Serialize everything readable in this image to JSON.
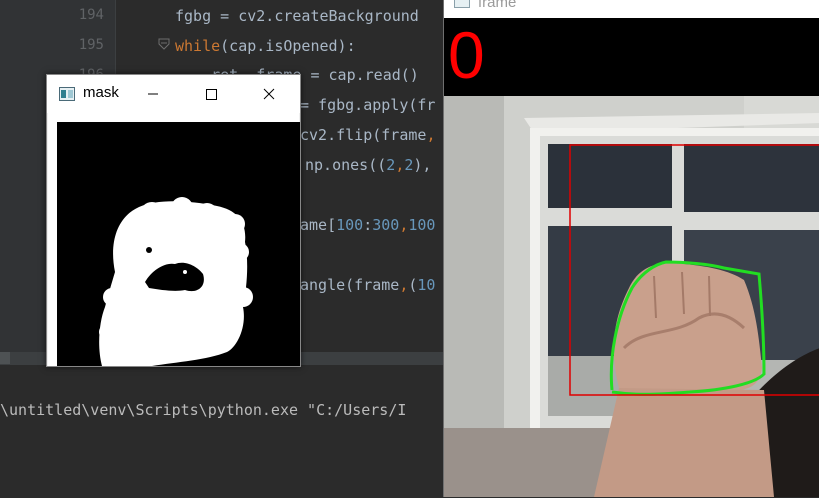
{
  "editor": {
    "line_numbers": [
      "194",
      "195",
      "196"
    ],
    "lines": {
      "l194": "fgbg = cv2.createBackground",
      "l195_kw": "while",
      "l195_rest": "(cap.isOpened):",
      "l196": "    ret, frame = cap.read()",
      "l197": "= fgbg.apply(fr",
      "l198_a": "cv2.flip(frame",
      "l198_b": ",",
      "l199_a": "np.ones((",
      "l199_n1": "2",
      "l199_c1": ",",
      "l199_n2": "2",
      "l199_b": "),",
      "l200_a": "ame[",
      "l200_n1": "100",
      "l200_b": ":",
      "l200_n2": "300",
      "l200_c1": ",",
      "l200_n3": "100",
      "l201_a": "angle(frame",
      "l201_c1": ",",
      "l201_b": "(",
      "l201_n1": "10"
    }
  },
  "console": {
    "command": "\\untitled\\venv\\Scripts\\python.exe \"C:/Users/I"
  },
  "mask_window": {
    "title": "mask",
    "icon": "opencv-window-icon",
    "buttons": [
      "minimize-icon",
      "maximize-icon",
      "close-icon"
    ]
  },
  "frame_window": {
    "title": "frame",
    "finger_count": "0",
    "roi_color": "#e00000",
    "contour_color": "#22dd22"
  },
  "colors": {
    "editor_bg": "#2b2b2b",
    "keyword": "#cc7832",
    "number": "#6897bb",
    "text": "#a9b7c6"
  }
}
